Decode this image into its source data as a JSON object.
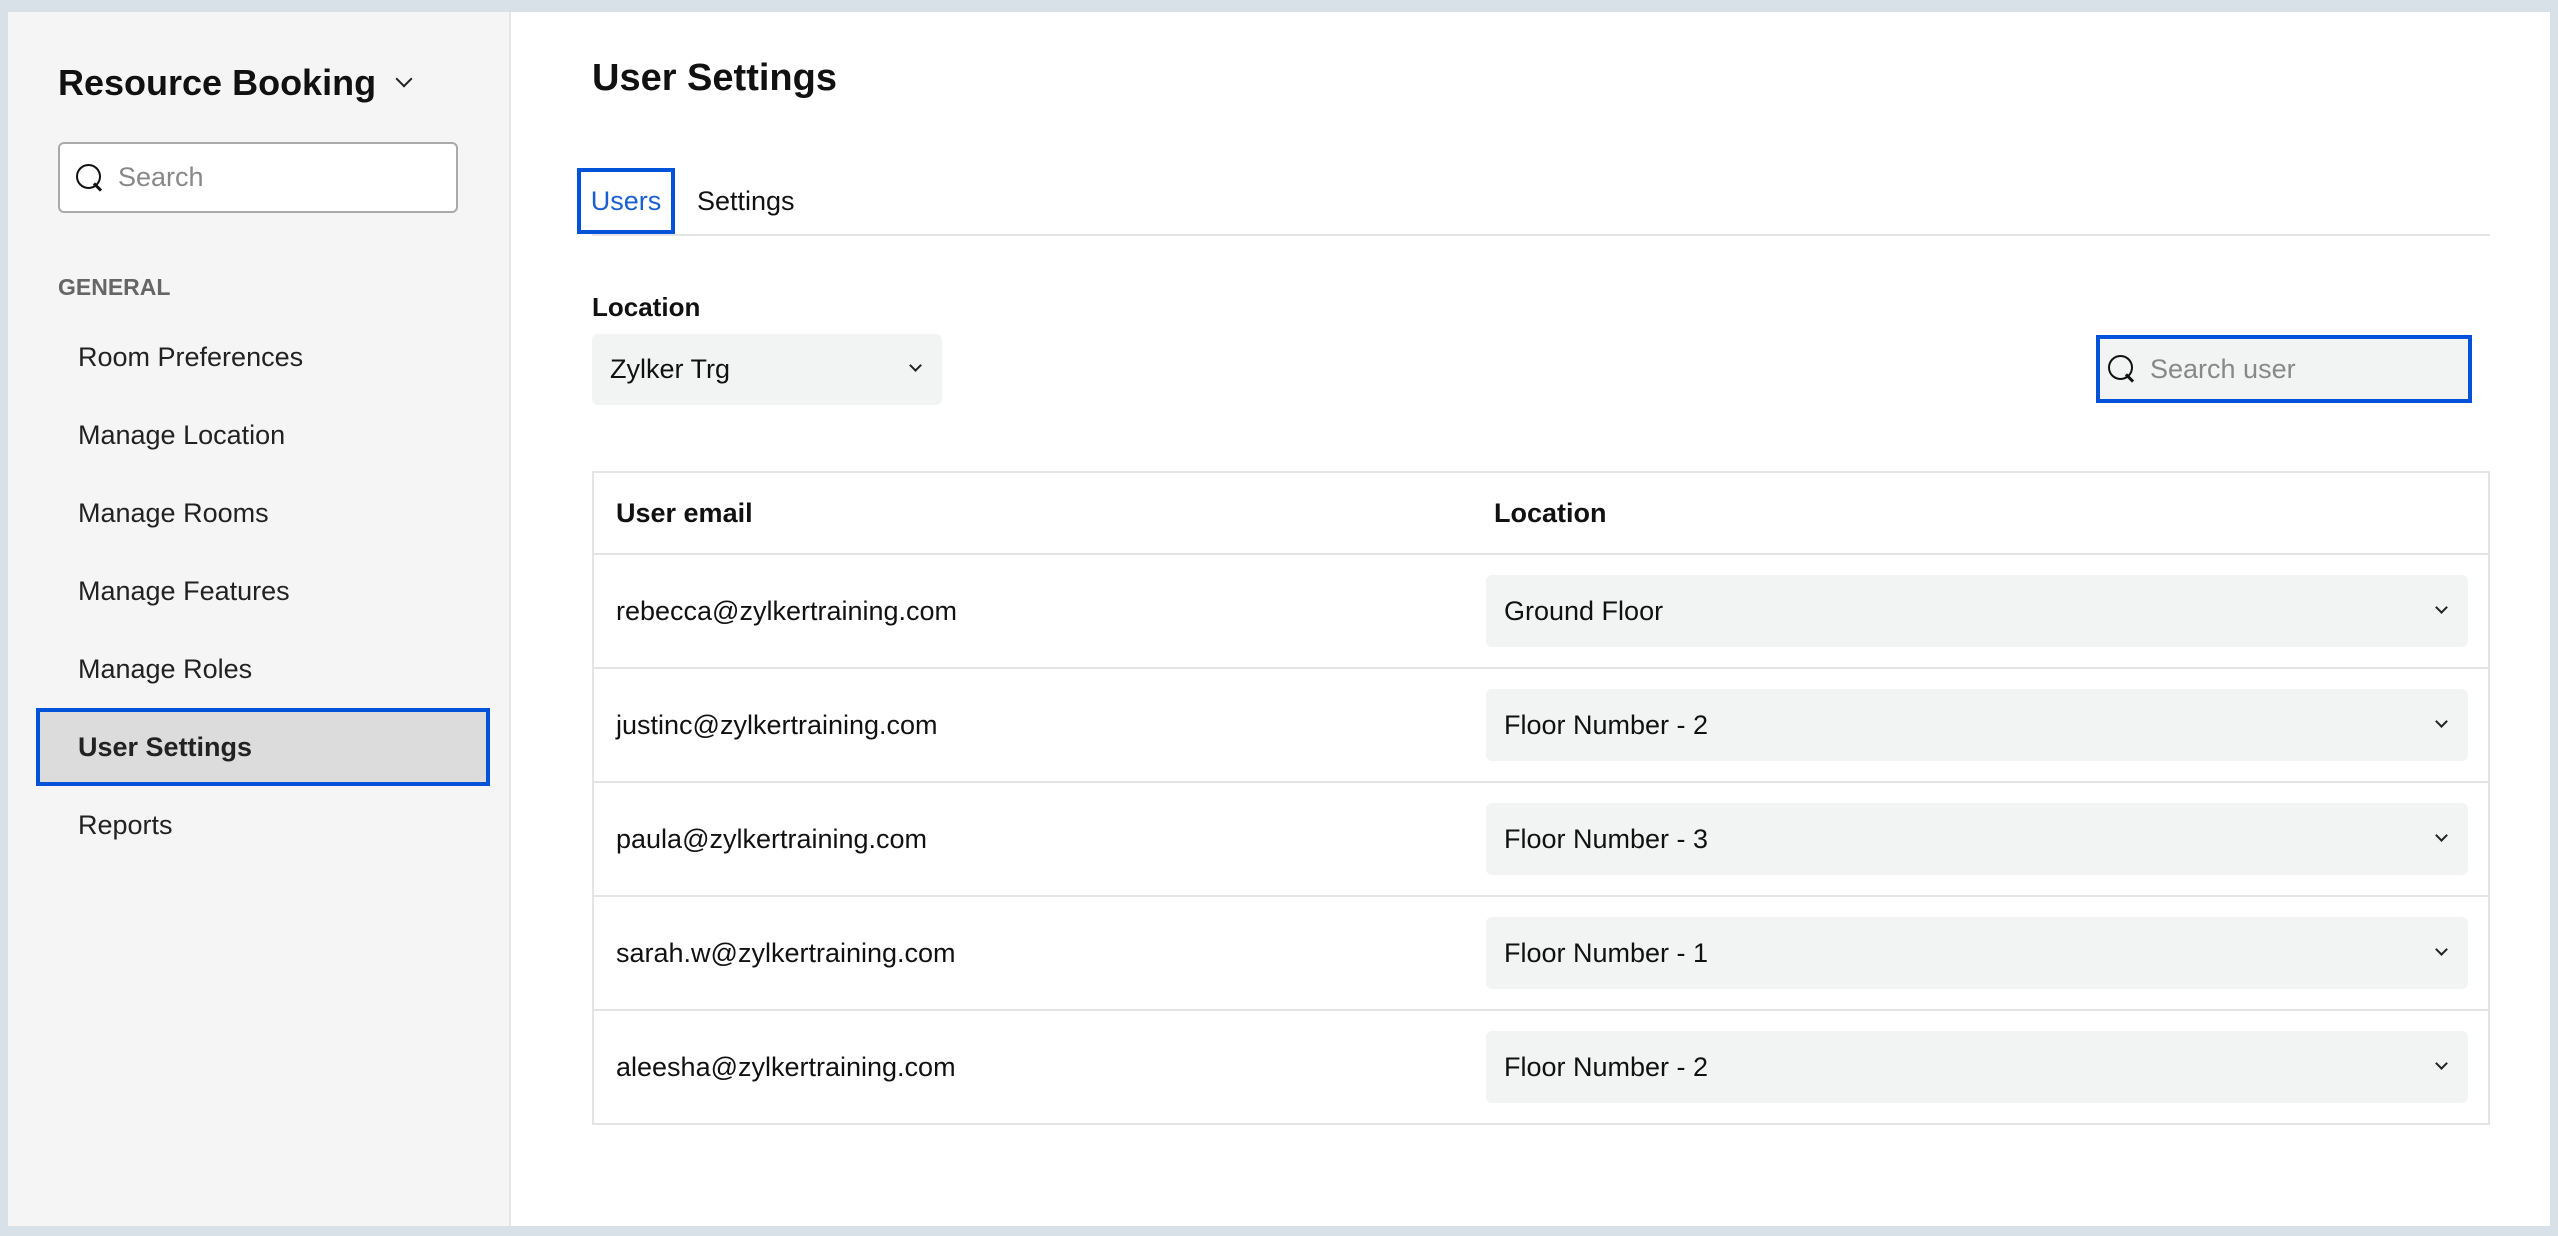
{
  "sidebar": {
    "app_title": "Resource Booking",
    "search_placeholder": "Search",
    "section": "GENERAL",
    "items": [
      {
        "label": "Room Preferences"
      },
      {
        "label": "Manage Location"
      },
      {
        "label": "Manage Rooms"
      },
      {
        "label": "Manage Features"
      },
      {
        "label": "Manage Roles"
      },
      {
        "label": "User Settings"
      },
      {
        "label": "Reports"
      }
    ],
    "active": "User Settings"
  },
  "main": {
    "title": "User Settings",
    "tabs": [
      {
        "label": "Users"
      },
      {
        "label": "Settings"
      }
    ],
    "location_label": "Location",
    "location_value": "Zylker Trg",
    "search_placeholder": "Search user",
    "table": {
      "headers": [
        "User email",
        "Location"
      ],
      "rows": [
        {
          "email": "rebecca@zylkertraining.com",
          "location": "Ground Floor"
        },
        {
          "email": "justinc@zylkertraining.com",
          "location": "Floor Number - 2"
        },
        {
          "email": "paula@zylkertraining.com",
          "location": "Floor Number - 3"
        },
        {
          "email": "sarah.w@zylkertraining.com",
          "location": "Floor Number - 1"
        },
        {
          "email": "aleesha@zylkertraining.com",
          "location": "Floor Number - 2"
        }
      ]
    }
  },
  "colors": {
    "accent": "#0052d9",
    "sidebar_bg": "#f5f5f5"
  }
}
